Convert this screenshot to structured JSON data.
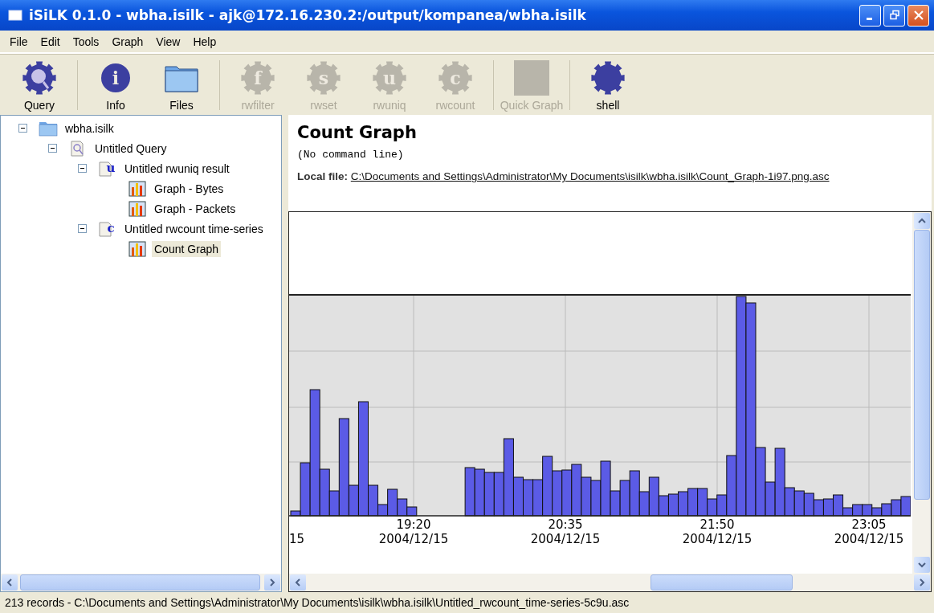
{
  "window": {
    "title": "iSiLK 0.1.0 - wbha.isilk - ajk@172.16.230.2:/output/kompanea/wbha.isilk"
  },
  "menu": [
    "File",
    "Edit",
    "Tools",
    "Graph",
    "View",
    "Help"
  ],
  "toolbar": [
    [
      {
        "label": "Query",
        "kind": "query",
        "disabled": false
      }
    ],
    [
      {
        "label": "Info",
        "kind": "info",
        "glyph": "i",
        "disabled": false
      },
      {
        "label": "Files",
        "kind": "folder",
        "disabled": false
      }
    ],
    [
      {
        "label": "rwfilter",
        "kind": "gear",
        "glyph": "f",
        "disabled": true
      },
      {
        "label": "rwset",
        "kind": "gear",
        "glyph": "s",
        "disabled": true
      },
      {
        "label": "rwuniq",
        "kind": "gear",
        "glyph": "u",
        "disabled": true
      },
      {
        "label": "rwcount",
        "kind": "gear",
        "glyph": "c",
        "disabled": true
      }
    ],
    [
      {
        "label": "Quick Graph",
        "kind": "square",
        "disabled": true
      }
    ],
    [
      {
        "label": "shell",
        "kind": "gear",
        "disabled": false
      }
    ]
  ],
  "tree": [
    {
      "label": "wbha.isilk",
      "kind": "folder",
      "expanded": true,
      "selected": false,
      "children": [
        {
          "label": "Untitled Query",
          "kind": "query",
          "expanded": true,
          "selected": false,
          "children": [
            {
              "label": "Untitled rwuniq result",
              "kind": "doc",
              "glyph": "u",
              "expanded": true,
              "selected": false,
              "children": [
                {
                  "label": "Graph - Bytes",
                  "kind": "graph",
                  "selected": false
                },
                {
                  "label": "Graph - Packets",
                  "kind": "graph",
                  "selected": false
                }
              ]
            },
            {
              "label": "Untitled rwcount time-series",
              "kind": "doc",
              "glyph": "c",
              "expanded": true,
              "selected": false,
              "children": [
                {
                  "label": "Count Graph",
                  "kind": "graph",
                  "selected": true
                }
              ]
            }
          ]
        }
      ]
    }
  ],
  "detail": {
    "title": "Count Graph",
    "command": "(No command line)",
    "local_file_label": "Local file:",
    "local_file": "C:\\Documents and Settings\\Administrator\\My Documents\\isilk\\wbha.isilk\\Count_Graph-1i97.png.asc"
  },
  "chart": {
    "axis_labels": [
      {
        "date": "15"
      },
      {
        "time": "19:20",
        "date": "2004/12/15"
      },
      {
        "time": "20:35",
        "date": "2004/12/15"
      },
      {
        "time": "21:50",
        "date": "2004/12/15"
      },
      {
        "time": "23:05",
        "date": "2004/12/15"
      }
    ]
  },
  "status_bar": "213 records - C:\\Documents and Settings\\Administrator\\My Documents\\isilk\\wbha.isilk\\Untitled_rwcount_time-series-5c9u.asc"
}
